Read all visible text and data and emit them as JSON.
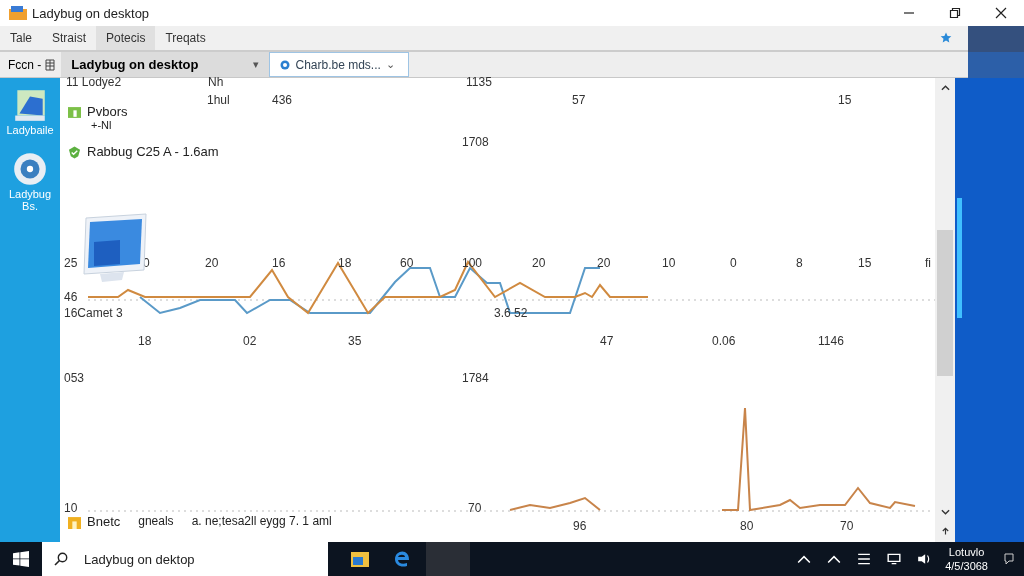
{
  "window": {
    "title": "Ladybug on desktop"
  },
  "menu": [
    {
      "label": "Tale",
      "selected": false
    },
    {
      "label": "Straist",
      "selected": false
    },
    {
      "label": "Potecis",
      "selected": true
    },
    {
      "label": "Treqats",
      "selected": false
    }
  ],
  "toolbar": {
    "dropdown": "Fccn -",
    "tabs": [
      {
        "label": "Ladybug on desktop",
        "caret": "▾",
        "selected": false
      },
      {
        "label": "Charb.be mds...",
        "caret": "⌄",
        "selected": true
      }
    ]
  },
  "desktop_icons": [
    {
      "label": "Ladybaile"
    },
    {
      "label": "Ladybug Bs."
    }
  ],
  "content": {
    "texts": [
      "11 Lodye2",
      "Nh",
      "1hul",
      "436",
      "1135",
      "57",
      "15",
      "1708",
      "25",
      "0",
      "20",
      "16",
      "18",
      "60",
      "100",
      "20",
      "20",
      "10",
      "0",
      "8",
      "15",
      "fi",
      "46",
      "16Camet 3",
      "3.6 52",
      "18",
      "02",
      "35",
      "47",
      "0.06",
      "1146",
      "053",
      "1784",
      "10",
      "70",
      "96",
      "80",
      "70"
    ],
    "items": [
      {
        "kind": "folder",
        "label": "Pvbors",
        "sub": "+-Nl"
      },
      {
        "kind": "shield",
        "label": "Rabbug C25  A  - 1.6am"
      },
      {
        "kind": "package",
        "label": "Bnetc",
        "col2": "gneals",
        "col3": "a. ne;tesa2ll eygg 7. 1 aml"
      }
    ]
  },
  "taskbar": {
    "search_placeholder": "Ladybug on dektop",
    "time": "Lotuvlo",
    "date": "4/5/3068"
  }
}
